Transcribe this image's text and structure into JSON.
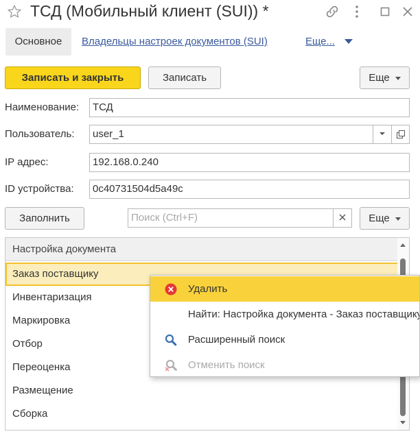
{
  "window": {
    "title": "ТСД (Мобильный клиент (SUI)) *"
  },
  "tabs": {
    "main": "Основное",
    "owners": "Владельцы настроек документов (SUI)",
    "more": "Еще..."
  },
  "toolbar": {
    "save_close": "Записать и закрыть",
    "save": "Записать",
    "more": "Еще"
  },
  "form": {
    "name_label": "Наименование:",
    "name_value": "ТСД",
    "user_label": "Пользователь:",
    "user_value": "user_1",
    "ip_label": "IP адрес:",
    "ip_value": "192.168.0.240",
    "device_label": "ID устройства:",
    "device_value": "0c40731504d5a49c"
  },
  "table_toolbar": {
    "fill": "Заполнить",
    "search_placeholder": "Поиск (Ctrl+F)",
    "more": "Еще"
  },
  "grid": {
    "header": "Настройка документа",
    "rows": [
      "Заказ поставщику",
      "Инвентаризация",
      "Маркировка",
      "Отбор",
      "Переоценка",
      "Размещение",
      "Сборка"
    ]
  },
  "context_menu": {
    "delete": "Удалить",
    "find": "Найти: Настройка документа - Заказ поставщику",
    "advanced_search": "Расширенный поиск",
    "cancel_search": "Отменить поиск"
  },
  "colors": {
    "accent_yellow": "#f9d61c",
    "link_blue": "#3a5a9d",
    "delete_red": "#e53935",
    "search_blue": "#3a6fb0"
  }
}
